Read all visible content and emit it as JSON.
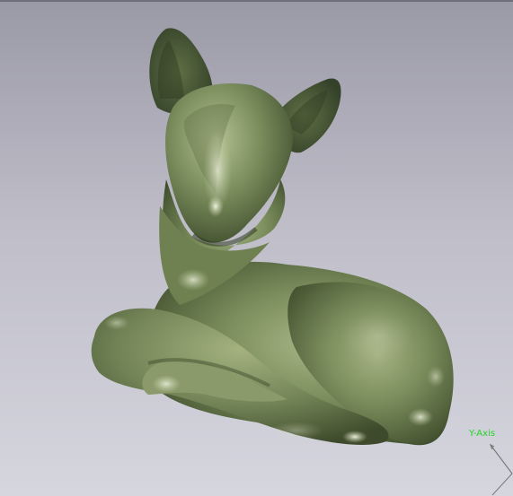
{
  "viewport": {
    "background_top": "#9a99a6",
    "background_bottom": "#d6d6df",
    "model_name": "deer-figurine-model",
    "model_color": "#7d8e5f"
  },
  "axis_indicator": {
    "label": "Y-Axis",
    "label_color": "#23d423",
    "axis_color": "#7a7a7a"
  }
}
